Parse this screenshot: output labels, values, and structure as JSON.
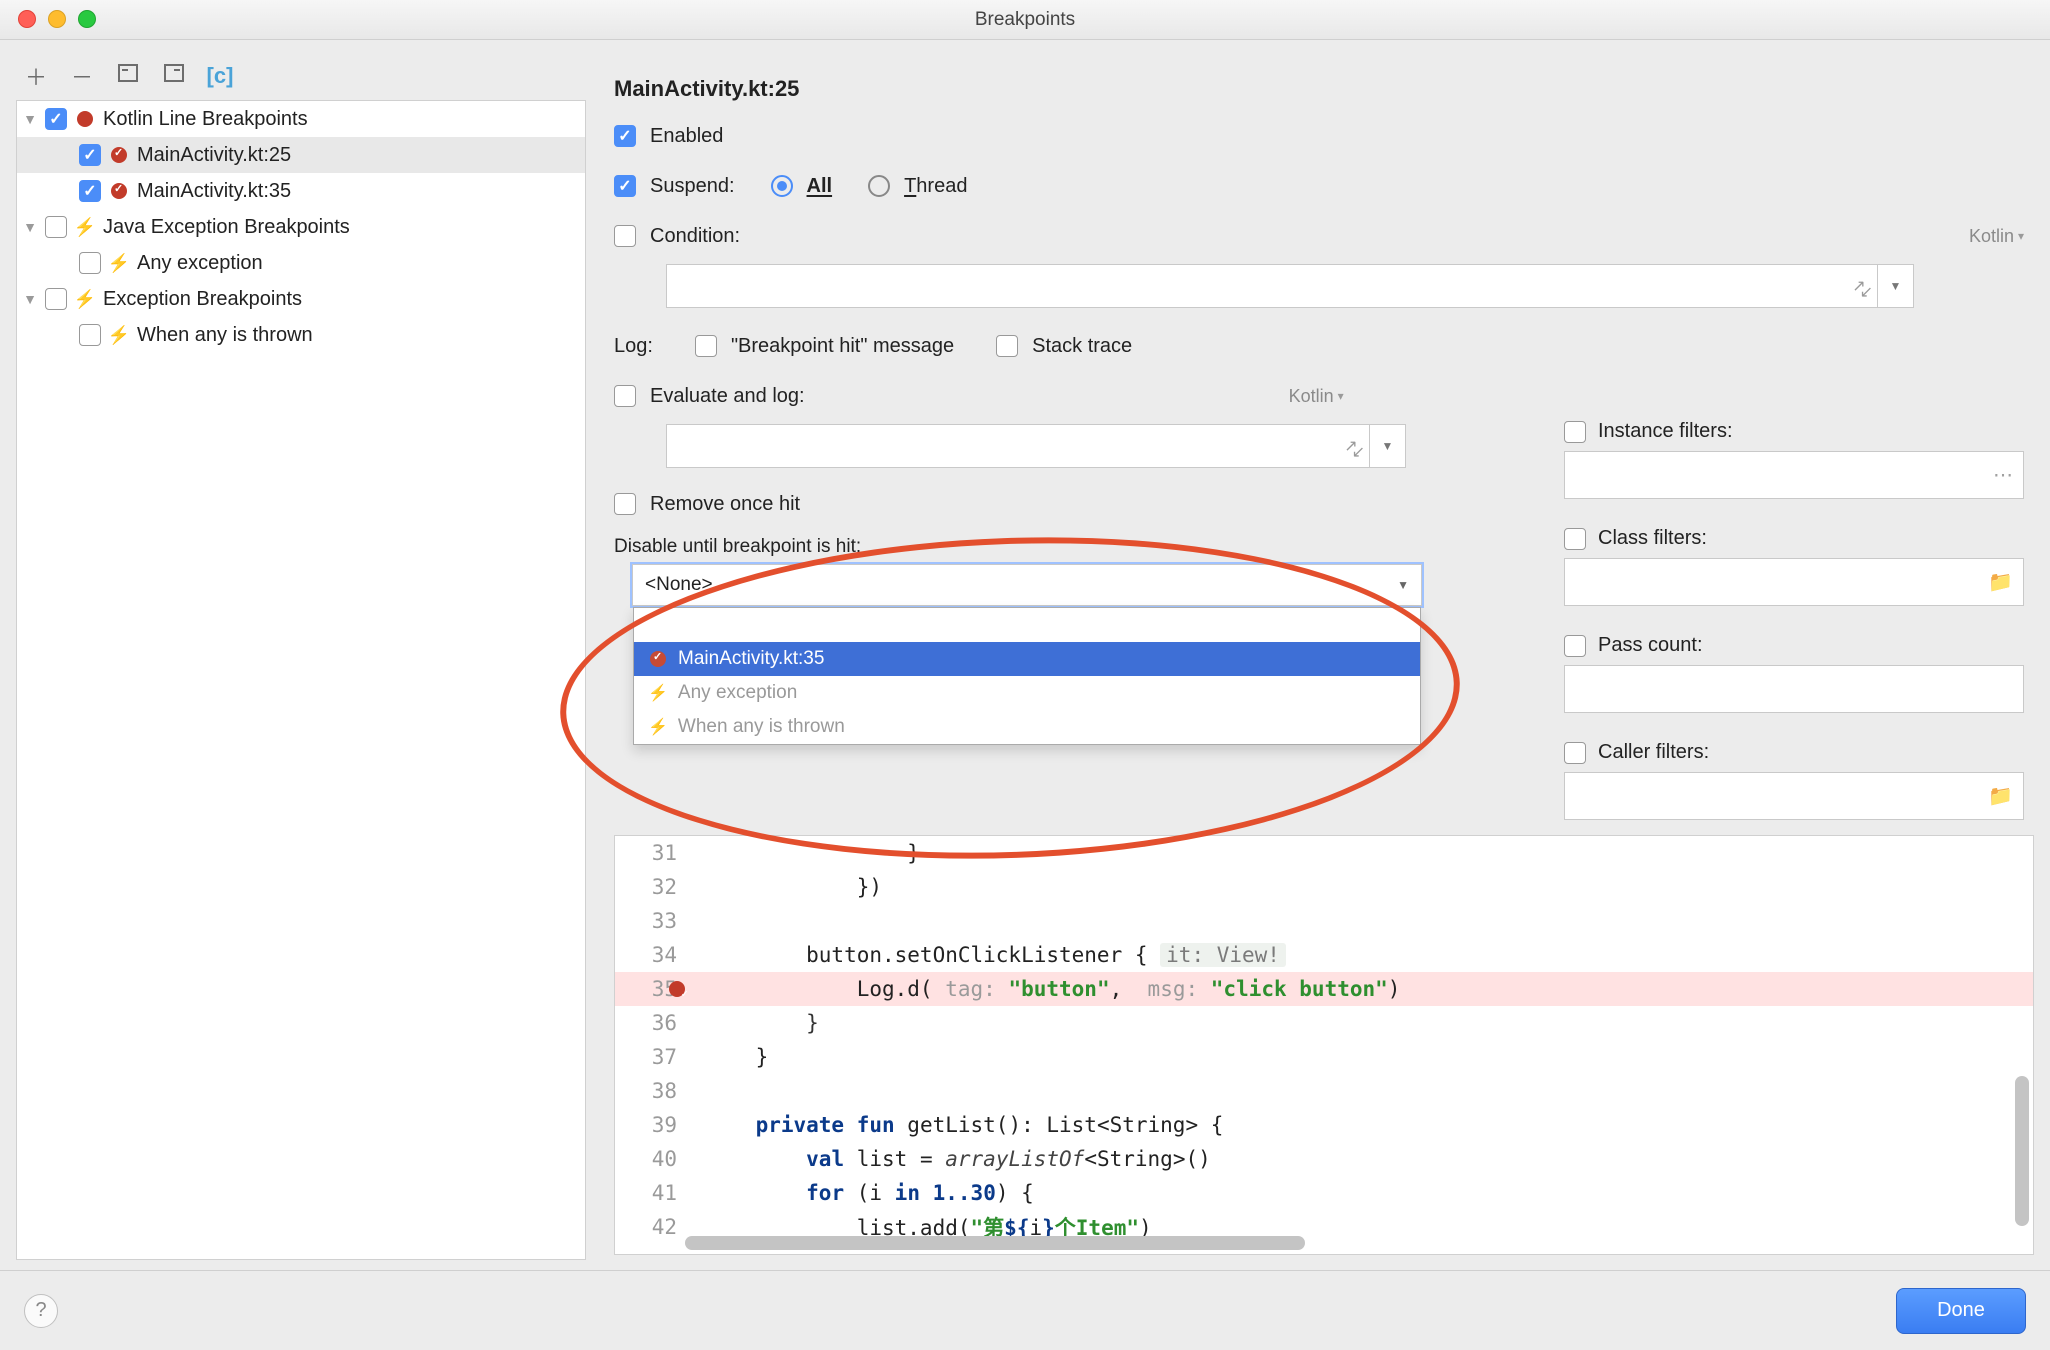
{
  "window": {
    "title": "Breakpoints"
  },
  "toolbar": {
    "add": "＋",
    "remove": "－",
    "expandAll": "expand-all",
    "collapseAll": "collapse-all",
    "viewMode": "view-mode"
  },
  "tree": {
    "groups": [
      {
        "label": "Kotlin Line Breakpoints",
        "checked": true,
        "icon": "breakpoint-dot",
        "open": true,
        "items": [
          {
            "label": "MainActivity.kt:25",
            "checked": true,
            "selected": true,
            "icon": "breakpoint-dot-checked"
          },
          {
            "label": "MainActivity.kt:35",
            "checked": true,
            "icon": "breakpoint-dot-checked"
          }
        ]
      },
      {
        "label": "Java Exception Breakpoints",
        "checked": false,
        "icon": "bolt",
        "open": true,
        "items": [
          {
            "label": "Any exception",
            "checked": false,
            "icon": "bolt"
          }
        ]
      },
      {
        "label": "Exception Breakpoints",
        "checked": false,
        "icon": "bolt",
        "open": true,
        "items": [
          {
            "label": "When any is thrown",
            "checked": false,
            "icon": "bolt"
          }
        ]
      }
    ]
  },
  "details": {
    "title": "MainActivity.kt:25",
    "enabled_label": "Enabled",
    "enabled": true,
    "suspend_label": "Suspend:",
    "suspend_checked": true,
    "suspend_mode": "All",
    "suspend_all": "All",
    "suspend_thread": "Thread",
    "condition_label": "Condition:",
    "condition_lang": "Kotlin",
    "log_label": "Log:",
    "log_bp_hit": "\"Breakpoint hit\" message",
    "log_stack": "Stack trace",
    "eval_log_label": "Evaluate and log:",
    "eval_lang": "Kotlin",
    "remove_once_label": "Remove once hit",
    "disable_until_label": "Disable until breakpoint is hit:",
    "disable_until_value": "<None>",
    "disable_until_options": [
      {
        "label": "<None>",
        "enabled": true
      },
      {
        "label": "MainActivity.kt:35",
        "enabled": true,
        "selected": true,
        "icon": "breakpoint-dot-checked"
      },
      {
        "label": "Any exception",
        "enabled": false,
        "icon": "bolt"
      },
      {
        "label": "When any is thrown",
        "enabled": false,
        "icon": "bolt"
      }
    ],
    "instance_filters_label": "Instance filters:",
    "class_filters_label": "Class filters:",
    "pass_count_label": "Pass count:",
    "caller_filters_label": "Caller filters:"
  },
  "code": {
    "lines": [
      {
        "n": 31,
        "html": "                }"
      },
      {
        "n": 32,
        "html": "            })"
      },
      {
        "n": 33,
        "html": ""
      },
      {
        "n": 34,
        "html": "        button.setOnClickListener { <span class='hint'>it: View!</span>"
      },
      {
        "n": 35,
        "bp": true,
        "html": "            Log.d( <span class='k-gray'>tag:</span> <span class='k-green'>\"button\"</span>,  <span class='k-gray'>msg:</span> <span class='k-green'>\"click button\"</span>)"
      },
      {
        "n": 36,
        "html": "        <span class='punct'>}</span>"
      },
      {
        "n": 37,
        "html": "    }"
      },
      {
        "n": 38,
        "html": ""
      },
      {
        "n": 39,
        "html": "    <span class='k-navy'>private fun</span> getList(): List&lt;String&gt; {"
      },
      {
        "n": 40,
        "html": "        <span class='k-navy'>val</span> list = <span class='k-ital'>arrayListOf</span>&lt;String&gt;()"
      },
      {
        "n": 41,
        "html": "        <span class='k-navy'>for</span> (i <span class='k-navy'>in</span> <span class='k-navy'>1..30</span>) {"
      },
      {
        "n": 42,
        "html": "            list.add(<span class='k-green'>\"第</span><span class='k-navy'>${</span>i<span class='k-navy'>}</span><span class='k-green'>个Item\"</span>)"
      }
    ]
  },
  "footer": {
    "done": "Done"
  }
}
